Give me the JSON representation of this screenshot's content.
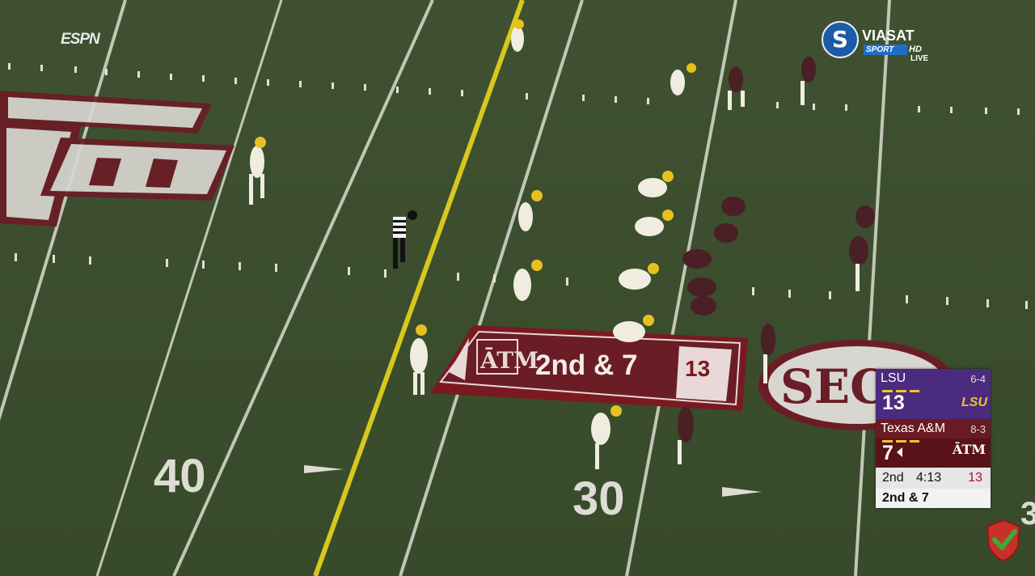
{
  "broadcast": {
    "network_logo": "ESPN",
    "channel": {
      "name": "VIASAT",
      "sub": "SPORT",
      "hd": "HD",
      "live": "LIVE",
      "icon": "viasat-s-icon"
    }
  },
  "scorebug": {
    "away": {
      "team": "LSU",
      "record": "6-4",
      "score": "13",
      "logo_text": "LSU",
      "color": "#4b2b7e"
    },
    "home": {
      "team": "Texas A&M",
      "record": "8-3",
      "score": "7",
      "logo_text": "ĀTM",
      "color": "#5a1219",
      "possession": true
    },
    "quarter": "2nd",
    "clock": "4:13",
    "play_clock": "13",
    "down_distance": "2nd & 7"
  },
  "field": {
    "end_logo": "ATM",
    "midfield_logo": "SEC",
    "yard_numbers": [
      "40",
      "30"
    ],
    "first_down_line_color": "#d8c81c",
    "banner": {
      "text": "2nd & 7",
      "logo": "ATM",
      "yard_marker": "13"
    }
  },
  "colors": {
    "turf": "#3c4f2e",
    "maroon": "#6b1d25",
    "lsu_gold": "#f2c230",
    "lsu_purple": "#4b2b7e"
  }
}
